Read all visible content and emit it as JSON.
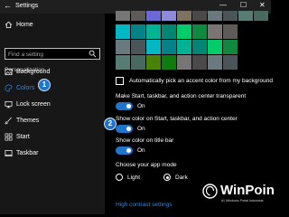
{
  "window": {
    "title": "Settings",
    "controls": [
      "—",
      "☐",
      "✕"
    ]
  },
  "sidebar": {
    "home_label": "Home",
    "search_placeholder": "Find a setting",
    "section_label": "Personalization",
    "items": [
      {
        "label": "Background",
        "icon": "image-icon"
      },
      {
        "label": "Colors",
        "icon": "palette-icon",
        "active": true
      },
      {
        "label": "Lock screen",
        "icon": "monitor-icon"
      },
      {
        "label": "Themes",
        "icon": "brush-icon"
      },
      {
        "label": "Start",
        "icon": "start-grid-icon"
      },
      {
        "label": "Taskbar",
        "icon": "taskbar-icon"
      }
    ]
  },
  "annotations": {
    "badge_1": "1",
    "badge_2": "2"
  },
  "colors": {
    "accent": "#1f75cc",
    "link": "#2f8ae0",
    "swatch_rows": [
      [
        "#767676",
        "#5d5a58",
        "#6b69d6",
        "#8e8cd8",
        "#7e735f",
        "#4c4a48",
        "#69797e",
        "#4a5459",
        "#567c73",
        "#486860"
      ],
      [
        "#00b7c3",
        "#038387",
        "#00b294",
        "#018574",
        "#00cc6a",
        "#10893e",
        "#7a7574",
        "#5d5a58"
      ],
      [
        "#69797e",
        "#4a5459",
        "#00b7c3",
        "#038387",
        "#00b294",
        "#018574",
        "#00cc6a",
        "#10893e"
      ],
      [
        "#567c73",
        "#486860",
        "#498205",
        "#107c10",
        "#767676",
        "#4c4a48",
        "#69797e",
        "#4a5459"
      ]
    ]
  },
  "main": {
    "auto_accent_label": "Automatically pick an accent color from my background",
    "transparency_label": "Make Start, taskbar, and action center transparent",
    "transparency_state": "On",
    "show_color_start_label": "Show color on Start, taskbar, and action center",
    "show_color_start_state": "On",
    "show_color_title_label": "Show color on title bar",
    "show_color_title_state": "On",
    "app_mode_label": "Choose your app mode",
    "app_mode_light": "Light",
    "app_mode_dark": "Dark",
    "high_contrast_link": "High contrast settings"
  },
  "watermark": {
    "name": "WinPoin",
    "tagline": "#1 Windows Portal Indonesia"
  }
}
